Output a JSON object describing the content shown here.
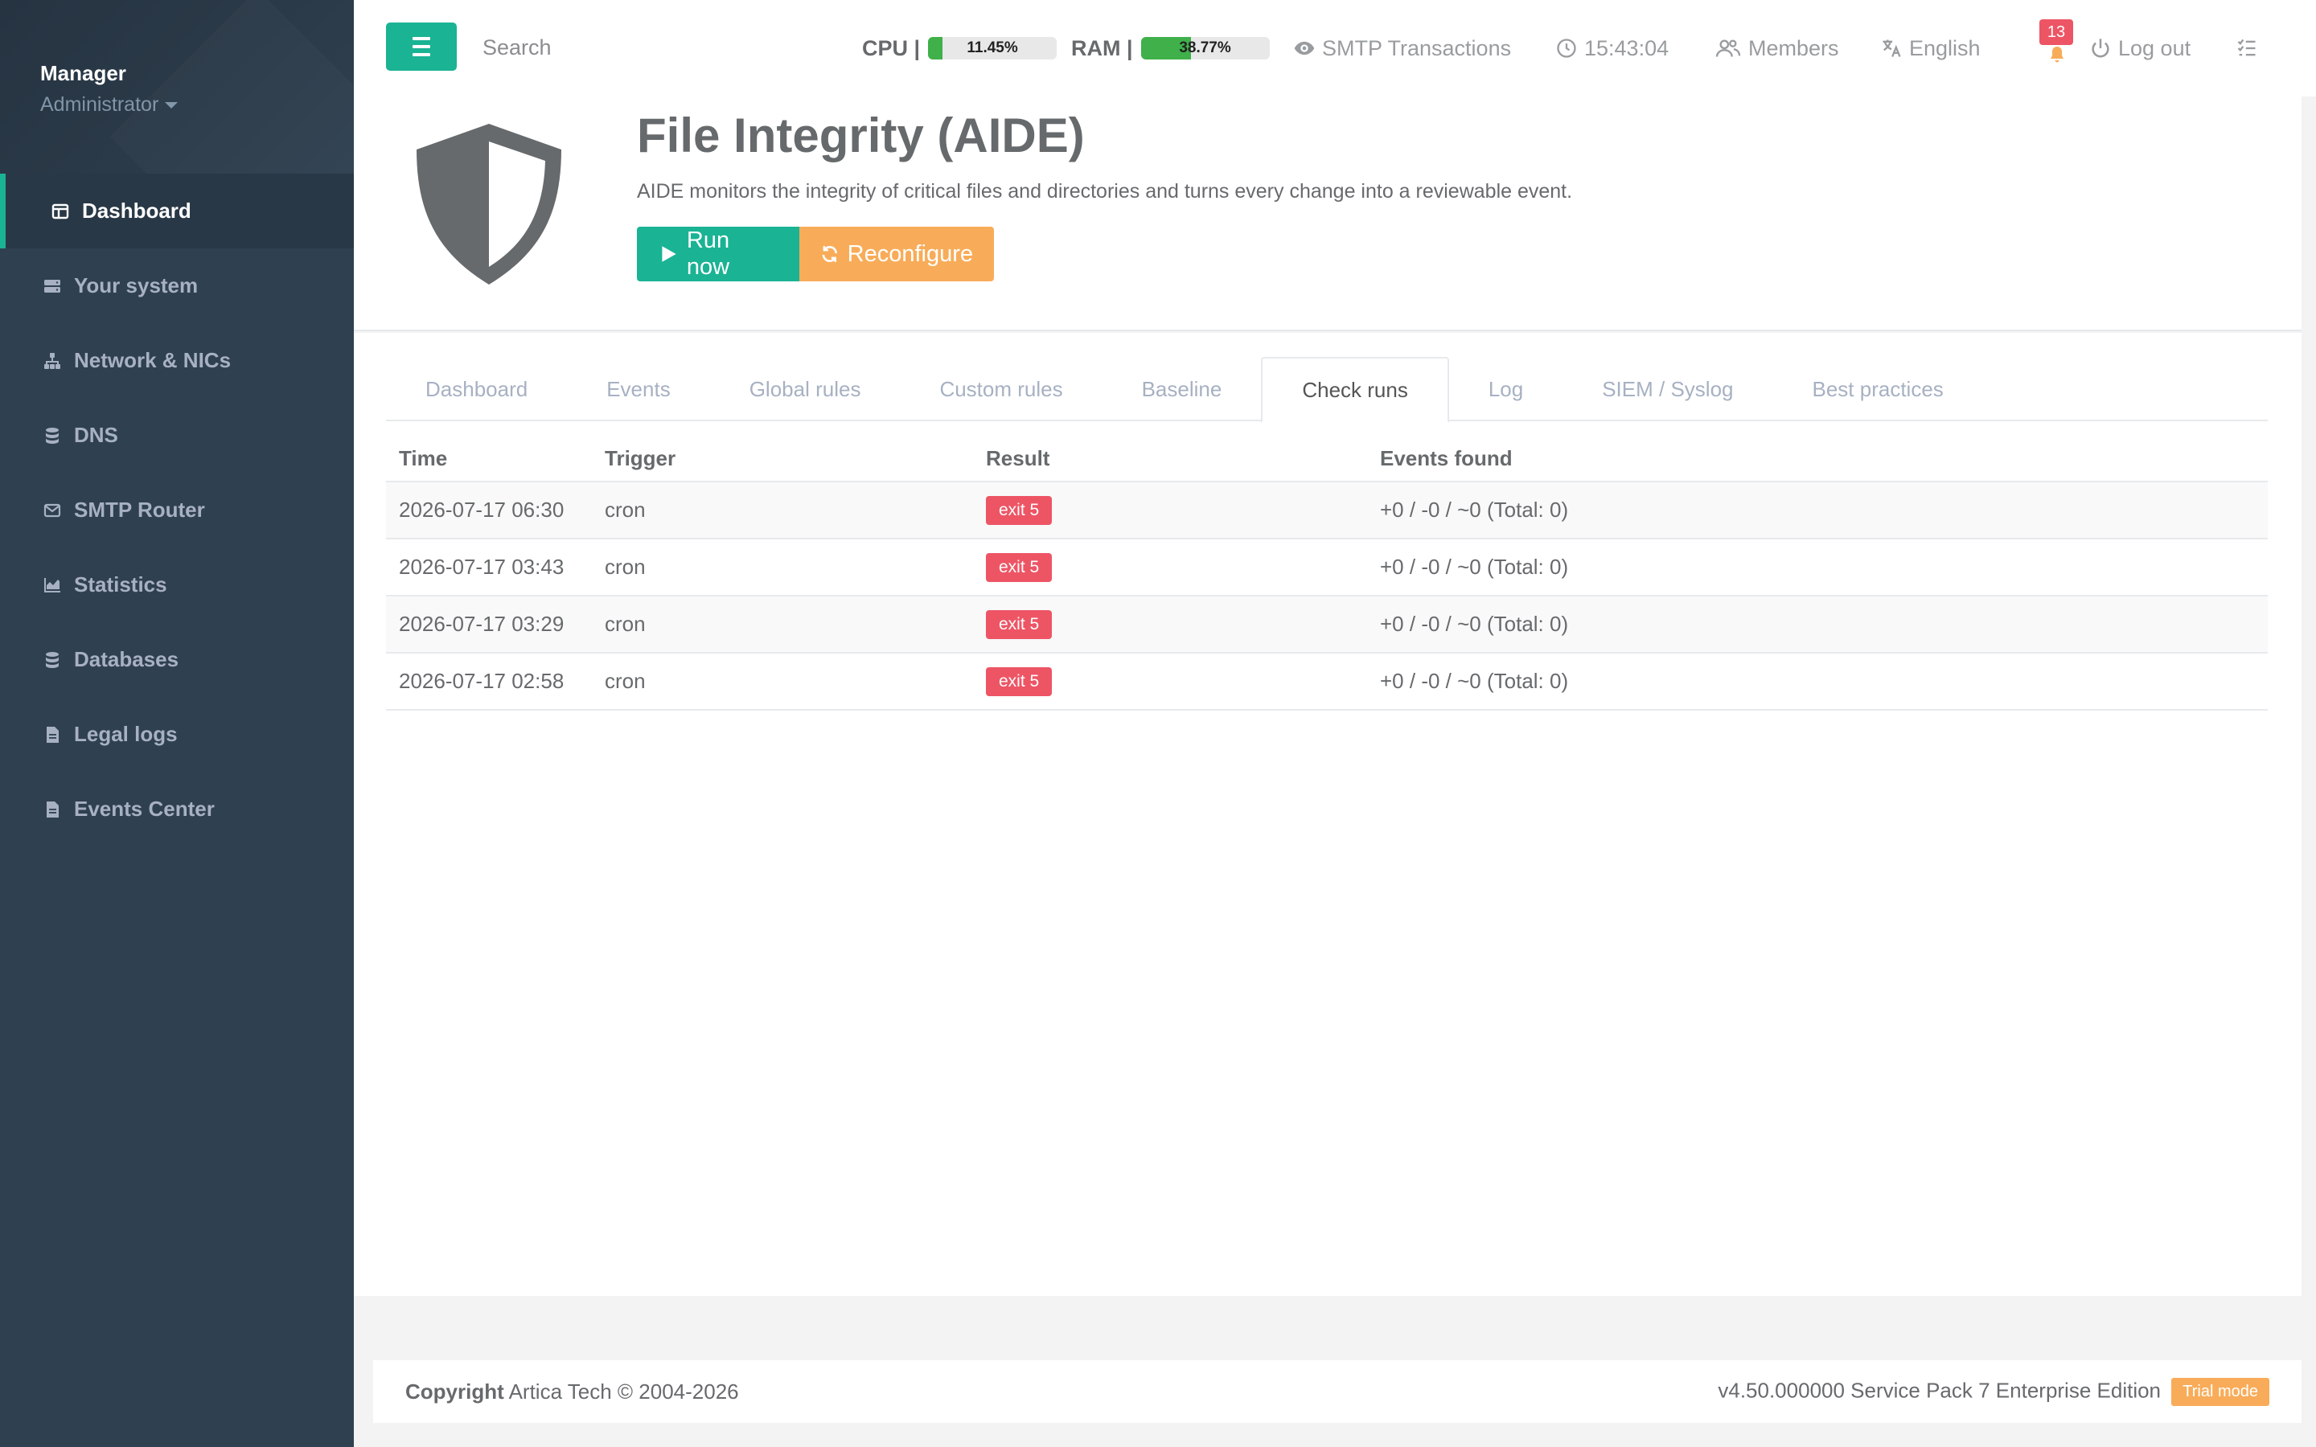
{
  "sidebar": {
    "profile_name": "Manager",
    "profile_role": "Administrator",
    "items": [
      {
        "label": "Dashboard",
        "icon": "dashboard-icon"
      },
      {
        "label": "Your system",
        "icon": "server-icon"
      },
      {
        "label": "Network & NICs",
        "icon": "network-icon"
      },
      {
        "label": "DNS",
        "icon": "database-icon"
      },
      {
        "label": "SMTP Router",
        "icon": "envelope-icon"
      },
      {
        "label": "Statistics",
        "icon": "chart-icon"
      },
      {
        "label": "Databases",
        "icon": "database-icon"
      },
      {
        "label": "Legal logs",
        "icon": "file-icon"
      },
      {
        "label": "Events Center",
        "icon": "file-icon"
      }
    ]
  },
  "topbar": {
    "search_placeholder": "Search",
    "cpu_label": "CPU |",
    "cpu_value": "11.45%",
    "cpu_fraction": 0.1145,
    "ram_label": "RAM |",
    "ram_value": "38.77%",
    "ram_fraction": 0.3877,
    "smtp": "SMTP Transactions",
    "clock": "15:43:04",
    "members": "Members",
    "language": "English",
    "notifications": "13",
    "logout": "Log out"
  },
  "header": {
    "title": "File Integrity (AIDE)",
    "description": "AIDE monitors the integrity of critical files and directories and turns every change into a reviewable event.",
    "run_label": "Run now",
    "reconfigure_label": "Reconfigure"
  },
  "tabs": [
    "Dashboard",
    "Events",
    "Global rules",
    "Custom rules",
    "Baseline",
    "Check runs",
    "Log",
    "SIEM / Syslog",
    "Best practices"
  ],
  "active_tab": "Check runs",
  "table": {
    "columns": [
      "Time",
      "Trigger",
      "Result",
      "Events found"
    ],
    "rows": [
      {
        "time": "2026-07-17 06:30",
        "trigger": "cron",
        "result": "exit 5",
        "events": "+0 / -0 / ~0 (Total: 0)"
      },
      {
        "time": "2026-07-17 03:43",
        "trigger": "cron",
        "result": "exit 5",
        "events": "+0 / -0 / ~0 (Total: 0)"
      },
      {
        "time": "2026-07-17 03:29",
        "trigger": "cron",
        "result": "exit 5",
        "events": "+0 / -0 / ~0 (Total: 0)"
      },
      {
        "time": "2026-07-17 02:58",
        "trigger": "cron",
        "result": "exit 5",
        "events": "+0 / -0 / ~0 (Total: 0)"
      }
    ]
  },
  "footer": {
    "copyright_bold": "Copyright",
    "copyright_text": "Artica Tech © 2004-2026",
    "version": "v4.50.000000 Service Pack 7 Enterprise Edition",
    "badge": "Trial mode"
  },
  "colors": {
    "accent": "#1ab394",
    "warning": "#f8ac59",
    "danger": "#ed5565",
    "sidebar": "#2f4050",
    "meter": "#3fb04a"
  }
}
